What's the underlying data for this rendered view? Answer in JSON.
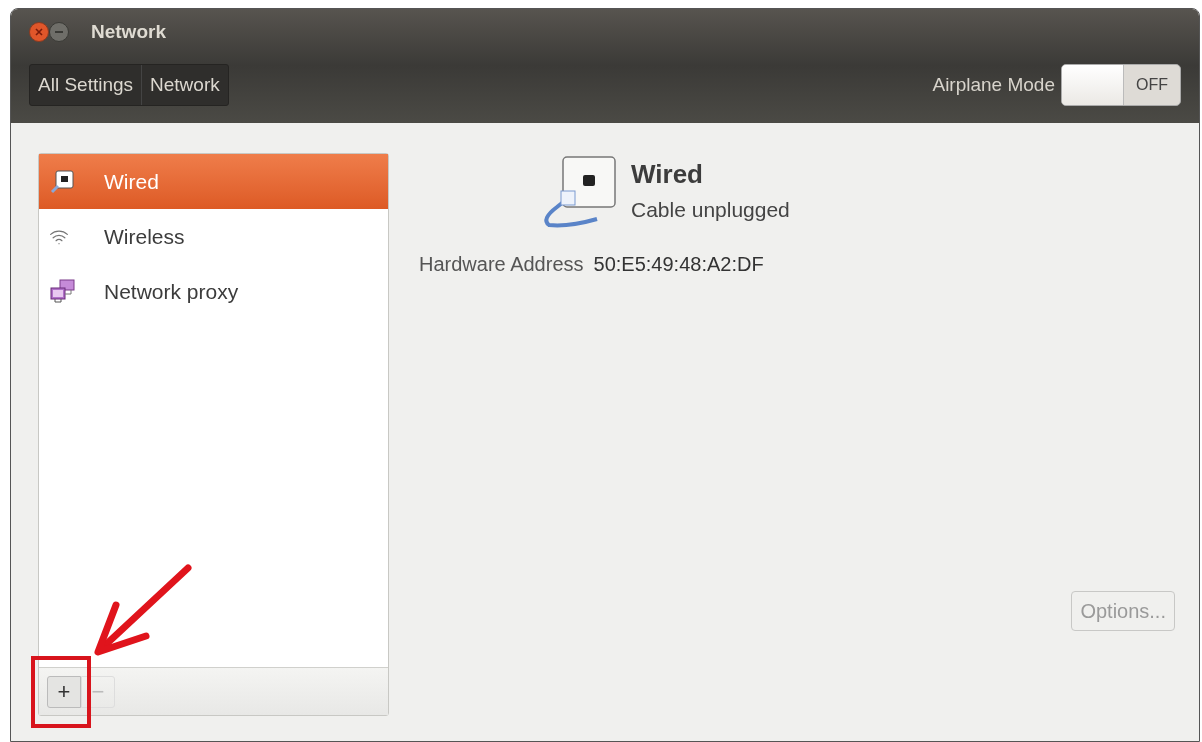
{
  "window": {
    "title": "Network",
    "buttons": [
      {
        "kind": "close"
      },
      {
        "kind": "minimize"
      }
    ]
  },
  "breadcrumbs": [
    {
      "label": "All Settings"
    },
    {
      "label": "Network"
    }
  ],
  "airplane_mode": {
    "label": "Airplane Mode",
    "on": false,
    "state_text": "OFF"
  },
  "sidebar": {
    "items": [
      {
        "label": "Wired",
        "kind": "wired",
        "selected": true
      },
      {
        "label": "Wireless",
        "kind": "wireless",
        "selected": false
      },
      {
        "label": "Network proxy",
        "kind": "proxy",
        "selected": false
      }
    ]
  },
  "list_toolbar": [
    {
      "label": "+",
      "kind": "add",
      "disabled": false
    },
    {
      "label": "−",
      "kind": "remove",
      "disabled": true
    }
  ],
  "detail": {
    "title": "Wired",
    "status": "Cable unplugged",
    "fields": [
      {
        "label": "Hardware Address",
        "value": "50:E5:49:48:A2:DF"
      }
    ]
  },
  "options_button": {
    "label": "Options...",
    "disabled": true
  }
}
